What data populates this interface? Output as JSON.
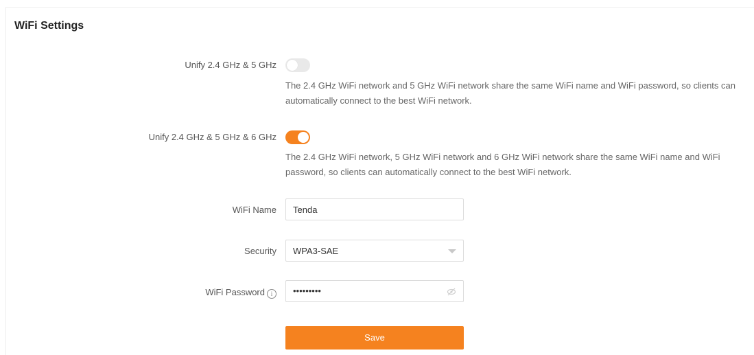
{
  "panel": {
    "title": "WiFi Settings"
  },
  "unify_24_5": {
    "label": "Unify 2.4 GHz & 5 GHz",
    "enabled": false,
    "description": "The 2.4 GHz WiFi network and 5 GHz WiFi network share the same WiFi name and WiFi password, so clients can automatically connect to the best WiFi network."
  },
  "unify_24_5_6": {
    "label": "Unify 2.4 GHz & 5 GHz & 6 GHz",
    "enabled": true,
    "description": "The 2.4 GHz WiFi network, 5 GHz WiFi network and 6 GHz WiFi network share the same WiFi name and WiFi password, so clients can automatically connect to the best WiFi network."
  },
  "wifi_name": {
    "label": "WiFi Name",
    "value": "Tenda"
  },
  "security": {
    "label": "Security",
    "selected": "WPA3-SAE"
  },
  "wifi_password": {
    "label": "WiFi Password",
    "masked_value": "•••••••••",
    "info_icon": "info-circle-icon",
    "visibility_icon": "eye-hidden-icon"
  },
  "save": {
    "label": "Save"
  },
  "colors": {
    "accent": "#f5821f",
    "toggle_off": "#e9e9e9"
  }
}
